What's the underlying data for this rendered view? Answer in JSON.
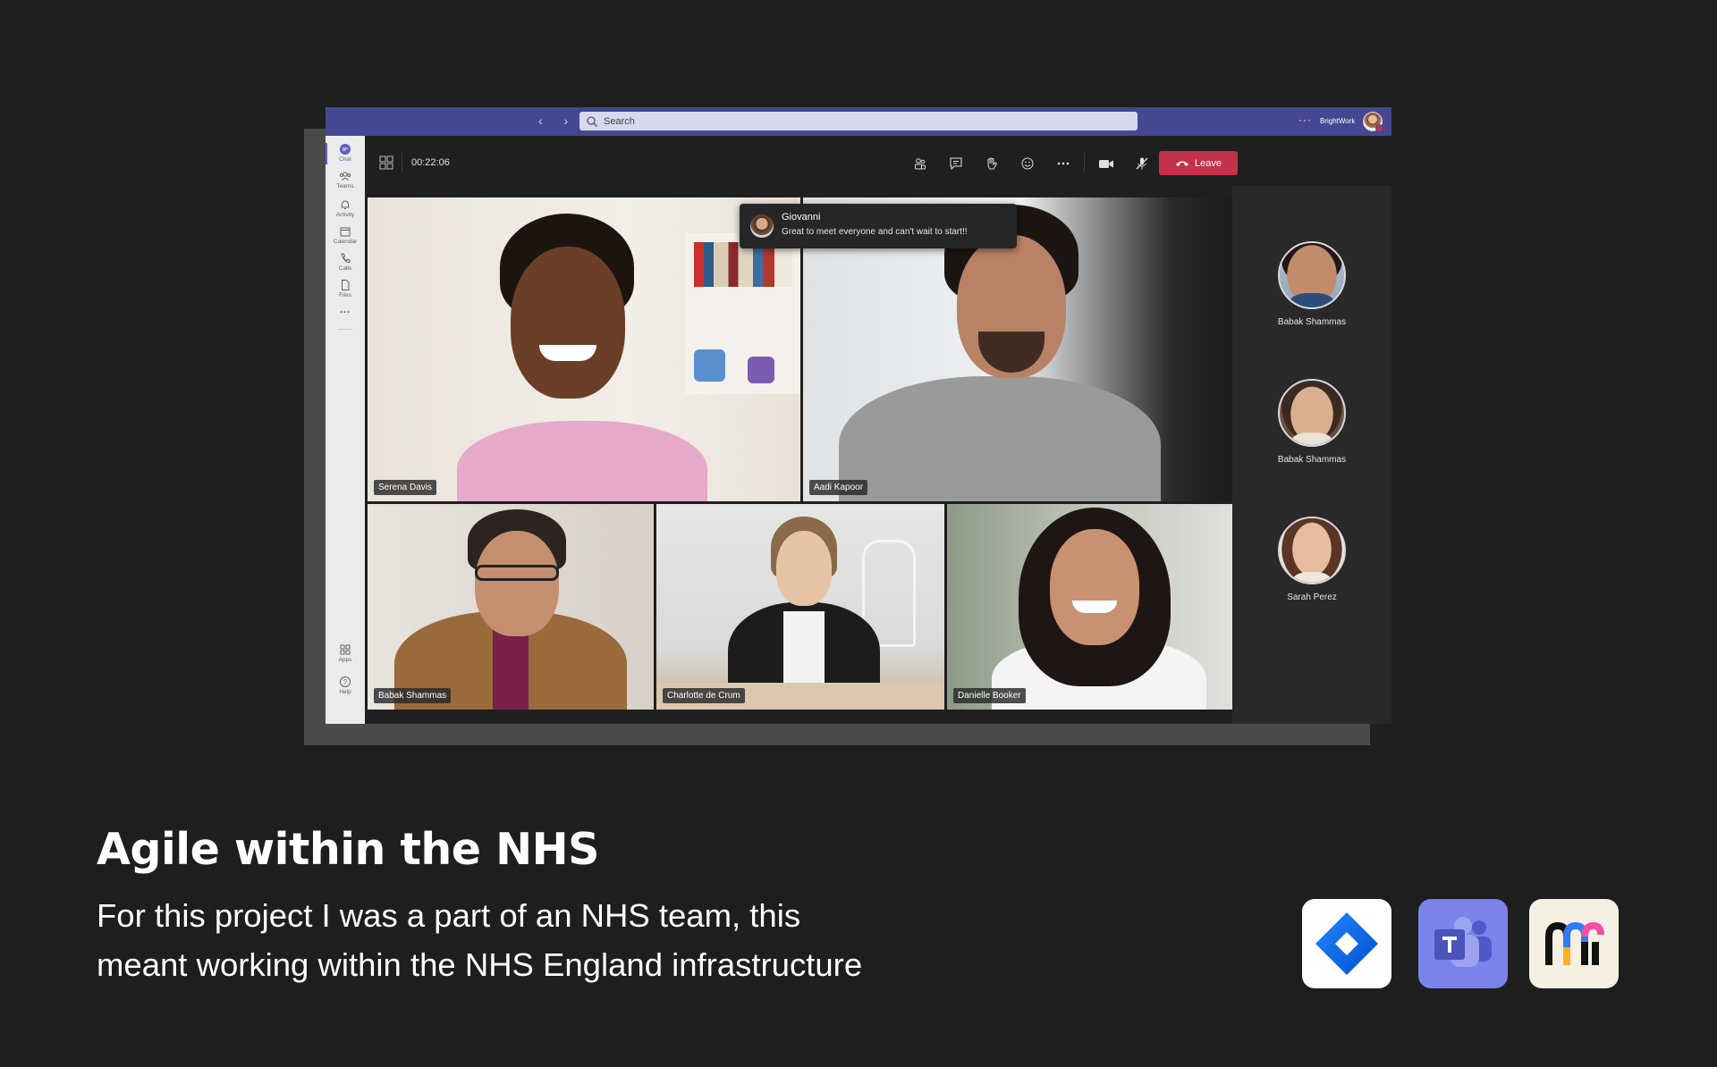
{
  "window": {
    "search_placeholder": "Search",
    "org_name": "BrightWork",
    "more_label": "···"
  },
  "rail": {
    "items": [
      {
        "label": "Chat",
        "icon": "chat-icon",
        "active": true
      },
      {
        "label": "Teams",
        "icon": "teams-icon"
      },
      {
        "label": "Activity",
        "icon": "bell-icon"
      },
      {
        "label": "Calendar",
        "icon": "calendar-icon"
      },
      {
        "label": "Calls",
        "icon": "phone-icon"
      },
      {
        "label": "Files",
        "icon": "file-icon"
      }
    ],
    "more_label": "···",
    "bottom_items": [
      {
        "label": "Apps",
        "icon": "apps-icon"
      },
      {
        "label": "Help",
        "icon": "help-icon"
      }
    ]
  },
  "meeting": {
    "timer": "00:22:06",
    "leave_label": "Leave",
    "accent": "#c4314b"
  },
  "chat_toast": {
    "sender": "Giovanni",
    "message": "Great to meet everyone and can't wait to start!!"
  },
  "tiles": [
    {
      "name": "Serena Davis"
    },
    {
      "name": "Aadi Kapoor"
    },
    {
      "name": "Babak Shammas"
    },
    {
      "name": "Charlotte de Crum"
    },
    {
      "name": "Danielle Booker"
    }
  ],
  "side_participants": [
    {
      "name": "Babak Shammas"
    },
    {
      "name": "Babak Shammas"
    },
    {
      "name": "Sarah Perez"
    }
  ],
  "page": {
    "title": "Agile within the NHS",
    "description_line1": "For this project I was a part of an NHS team, this",
    "description_line2": "meant working within the NHS England infrastructure"
  },
  "apps": [
    {
      "icon": "jira-icon",
      "color": "#2684ff"
    },
    {
      "icon": "teams-logo-icon",
      "color": "#5b5fc7"
    },
    {
      "icon": "miro-icon",
      "color": "#f5f0e1"
    }
  ]
}
